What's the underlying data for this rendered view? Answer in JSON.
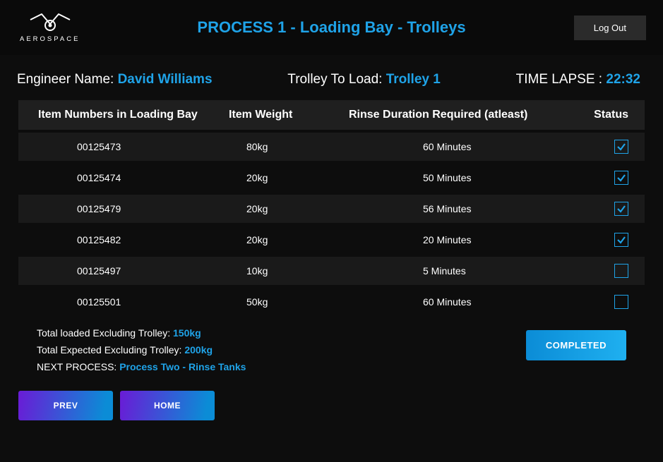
{
  "brand": "AEROSPACE",
  "header": {
    "title": "PROCESS 1 - Loading Bay - Trolleys",
    "logout": "Log Out"
  },
  "info": {
    "engineer_label": "Engineer Name: ",
    "engineer_name": "David Williams",
    "trolley_label": "Trolley To Load: ",
    "trolley_name": "Trolley 1",
    "time_label": "TIME LAPSE : ",
    "time_value": "22:32"
  },
  "table": {
    "headers": [
      "Item Numbers in Loading Bay",
      "Item Weight",
      "Rinse Duration Required (atleast)",
      "Status"
    ],
    "rows": [
      {
        "item": "00125473",
        "weight": "80kg",
        "duration": "60 Minutes",
        "checked": true,
        "shade": true
      },
      {
        "item": "00125474",
        "weight": "20kg",
        "duration": "50 Minutes",
        "checked": true,
        "shade": false
      },
      {
        "item": "00125479",
        "weight": "20kg",
        "duration": "56 Minutes",
        "checked": true,
        "shade": true
      },
      {
        "item": "00125482",
        "weight": "20kg",
        "duration": "20 Minutes",
        "checked": true,
        "shade": false
      },
      {
        "item": "00125497",
        "weight": "10kg",
        "duration": "5 Minutes",
        "checked": false,
        "shade": true
      },
      {
        "item": "00125501",
        "weight": "50kg",
        "duration": "60 Minutes",
        "checked": false,
        "shade": false
      }
    ]
  },
  "summary": {
    "loaded_label": "Total loaded Excluding Trolley:  ",
    "loaded_value": "150kg",
    "expected_label": "Total Expected Excluding Trolley: ",
    "expected_value": "200kg",
    "next_label": "NEXT PROCESS: ",
    "next_value": "Process Two - Rinse Tanks",
    "completed": "COMPLETED"
  },
  "buttons": {
    "prev": "PREV",
    "home": "HOME"
  }
}
